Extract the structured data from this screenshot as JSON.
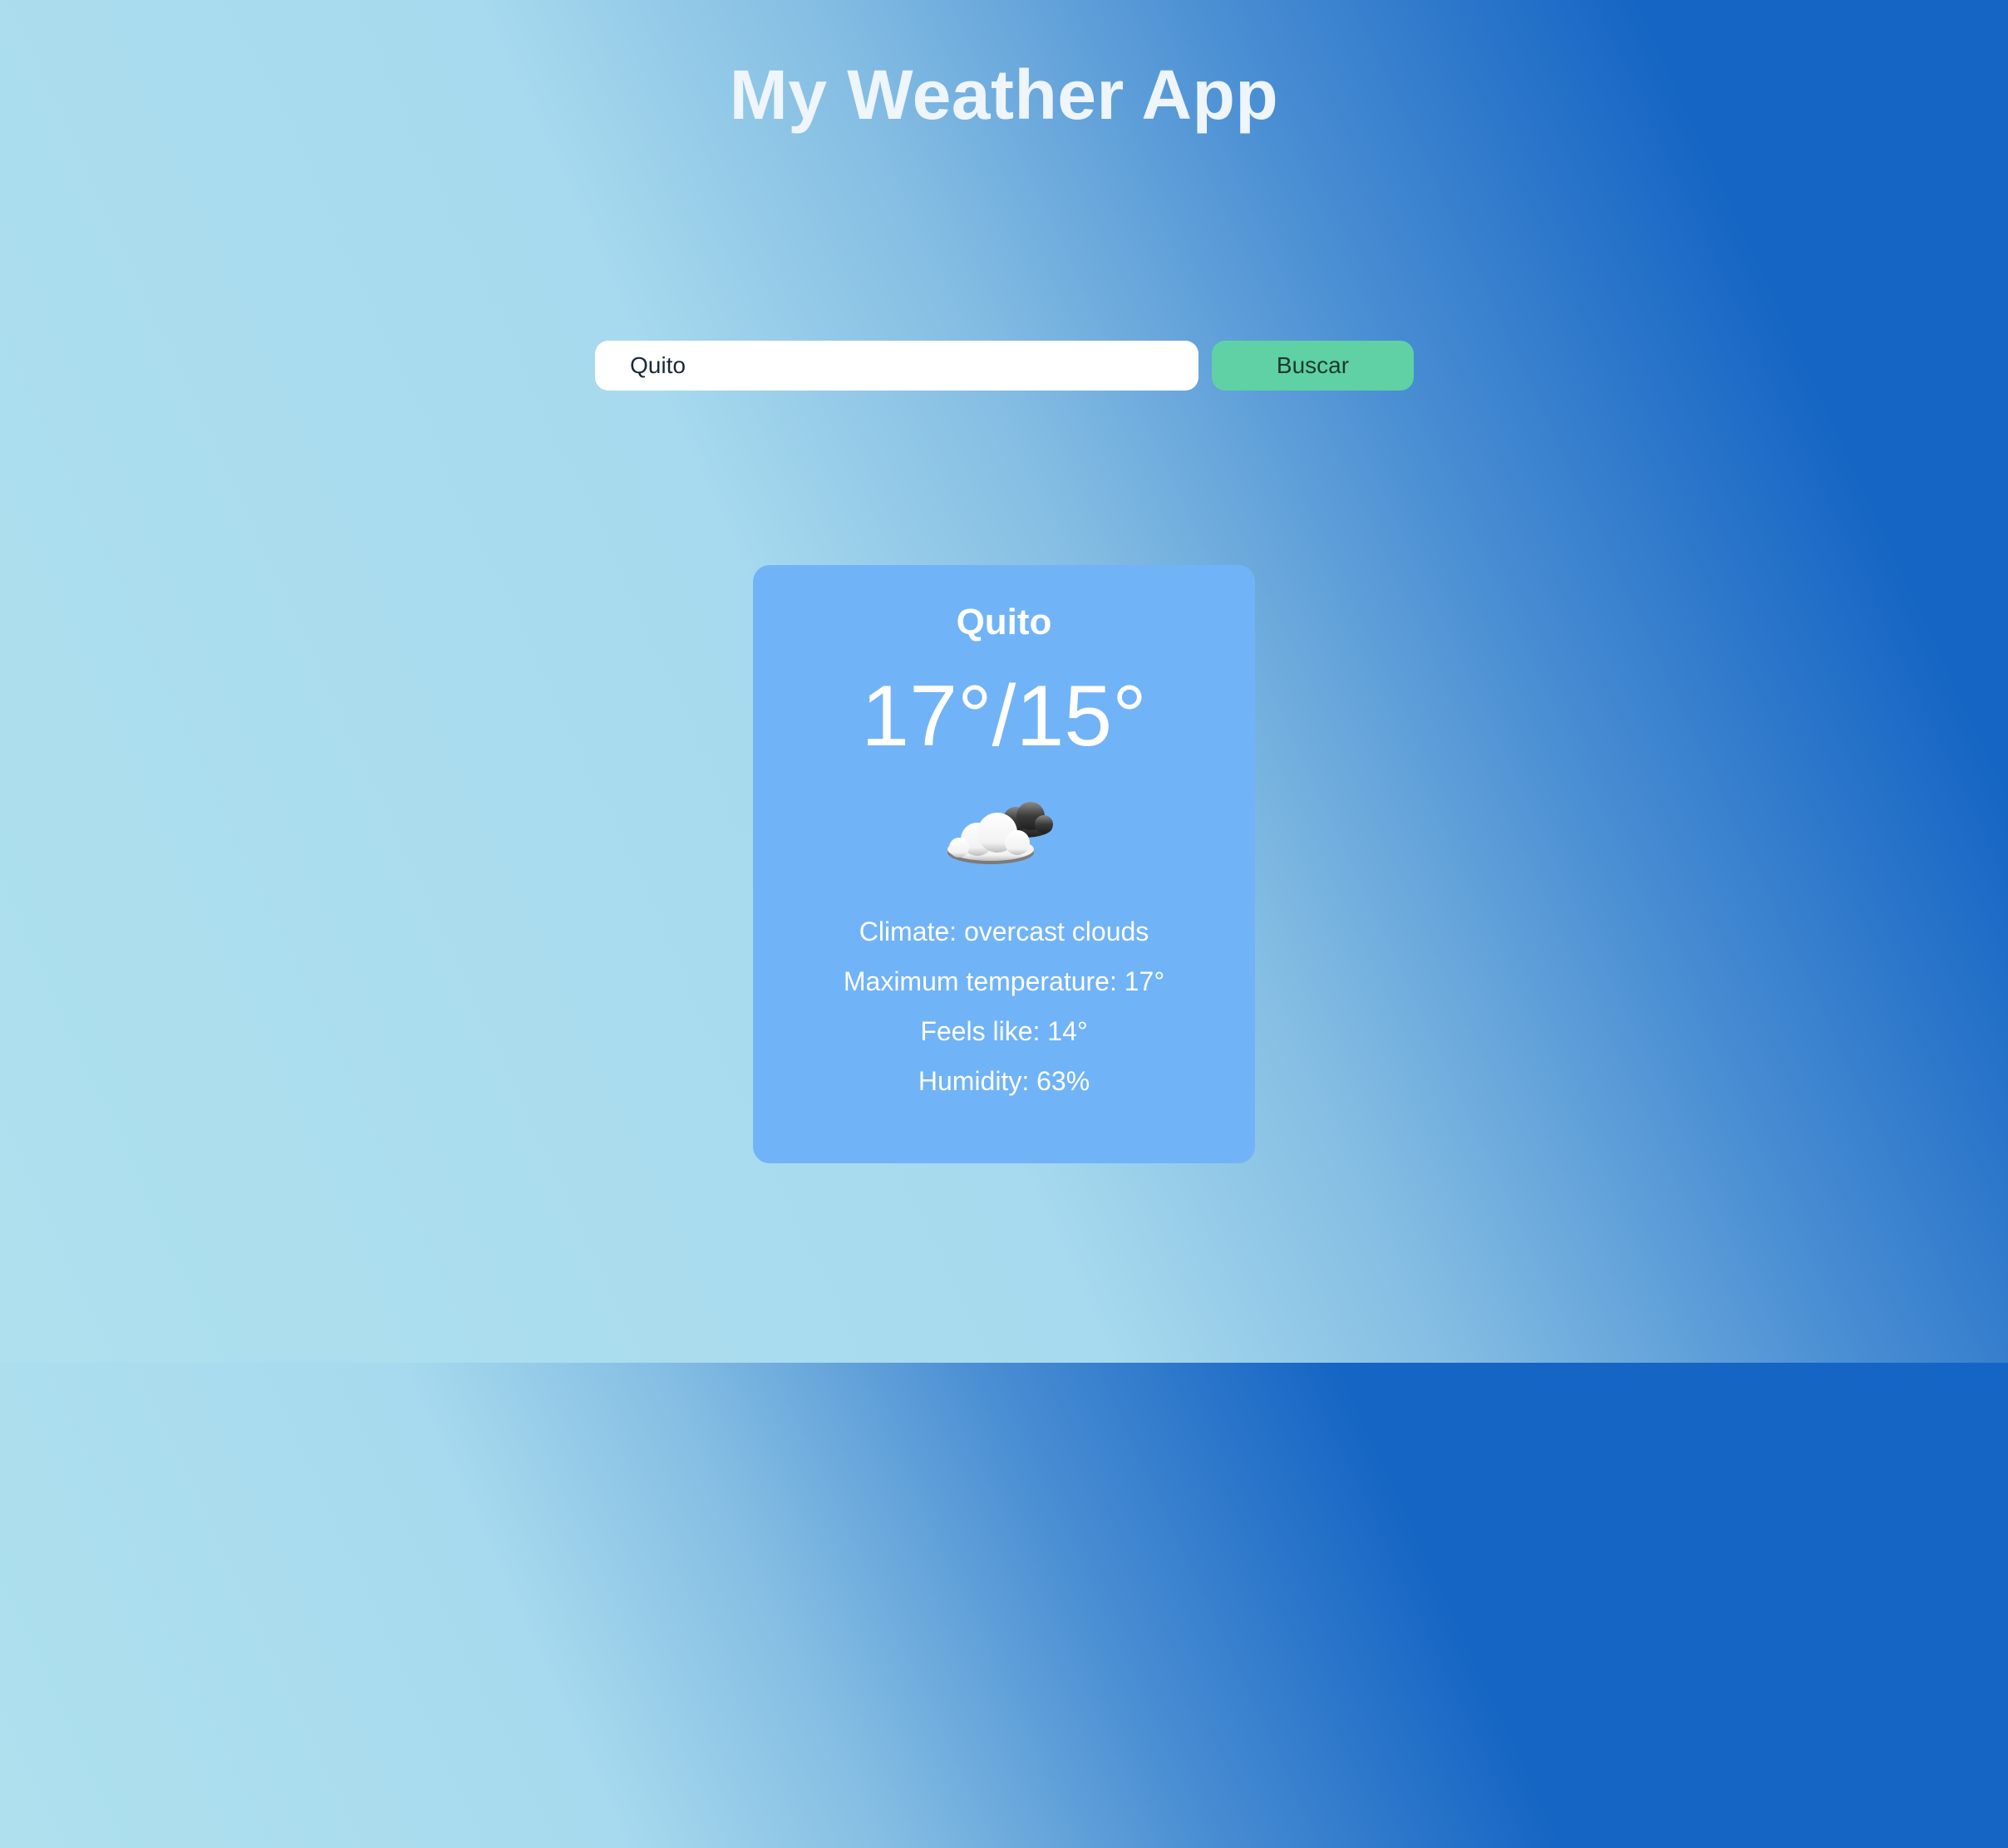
{
  "app": {
    "title": "My Weather App"
  },
  "search": {
    "value": "Quito",
    "button_label": "Buscar"
  },
  "weather_card": {
    "city": "Quito",
    "temperature_range": "17°/15°",
    "icon": "cloudy-icon",
    "details": [
      "Climate: overcast clouds",
      "Maximum temperature: 17°",
      "Feels like: 14°",
      "Humidity: 63%"
    ]
  },
  "colors": {
    "gradient_dark": "#1565c4",
    "gradient_light": "#aee0ee",
    "card_background": "#71b3f7",
    "button_background": "#5fd1a4"
  }
}
